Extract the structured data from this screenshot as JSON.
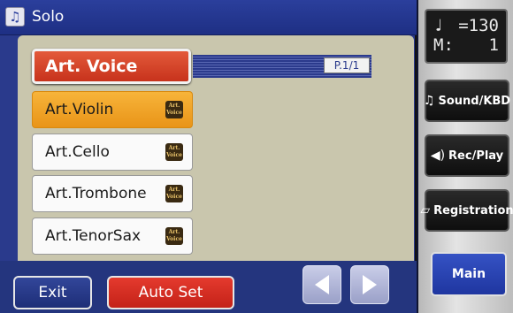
{
  "title_bar": {
    "icon": "music-notes-icon",
    "title": "Solo"
  },
  "category_button": {
    "label": "Art. Voice"
  },
  "page_indicator": "P.1/1",
  "voices": [
    {
      "label": "Art.Violin",
      "selected": true,
      "logo_line1": "Art.",
      "logo_line2": "Voice"
    },
    {
      "label": "Art.Cello",
      "selected": false,
      "logo_line1": "Art.",
      "logo_line2": "Voice"
    },
    {
      "label": "Art.Trombone",
      "selected": false,
      "logo_line1": "Art.",
      "logo_line2": "Voice"
    },
    {
      "label": "Art.TenorSax",
      "selected": false,
      "logo_line1": "Art.",
      "logo_line2": "Voice"
    }
  ],
  "bottom": {
    "exit_label": "Exit",
    "auto_set_label": "Auto Set"
  },
  "tempo": {
    "note": "♩",
    "tempo_value": "=130",
    "measure_label": "M:",
    "measure_value": "1"
  },
  "sidebar": {
    "sound_kbd_label": "Sound/KBD",
    "rec_play_label": "Rec/Play",
    "registration_label": "Registration",
    "main_label": "Main"
  },
  "colors": {
    "accent_red": "#d43a24",
    "selected_orange": "#f0a020",
    "panel_blue": "#2a3a8c",
    "content_bg": "#c9c6ad"
  }
}
